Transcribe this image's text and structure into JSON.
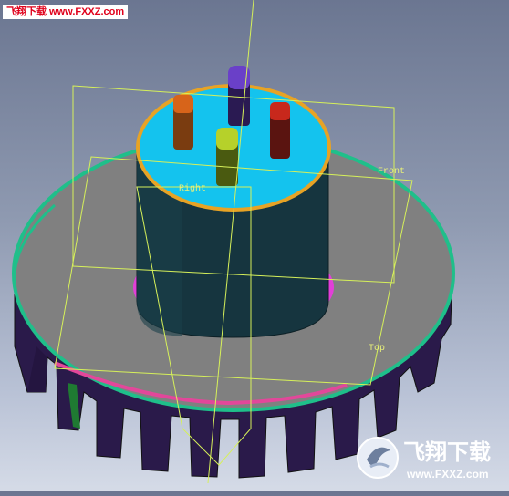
{
  "watermark_top": {
    "text": "飞翔下载 www.FXXZ.com"
  },
  "watermark_logo": {
    "title": "飞翔下载",
    "url": "www.FXXZ.com"
  },
  "viewport": {
    "plane_labels": {
      "front": "Front",
      "right": "Right",
      "top": "Top"
    }
  },
  "colors": {
    "background_top": "#6b7691",
    "background_bottom": "#d5dbe7",
    "flange": "#808080",
    "flange_edge": "#1fbf8a",
    "underside": "#2a1a4a",
    "cylinder": "#16353f",
    "cap": "#14c3ee",
    "cap_rim": "#e7a325",
    "magenta_band": "#e23fd8",
    "plane_lines": "#d6f05a",
    "post_orange": "#d7641a",
    "post_purple": "#6a40c8",
    "post_red": "#c8281c",
    "post_yellow": "#b6d12a"
  }
}
